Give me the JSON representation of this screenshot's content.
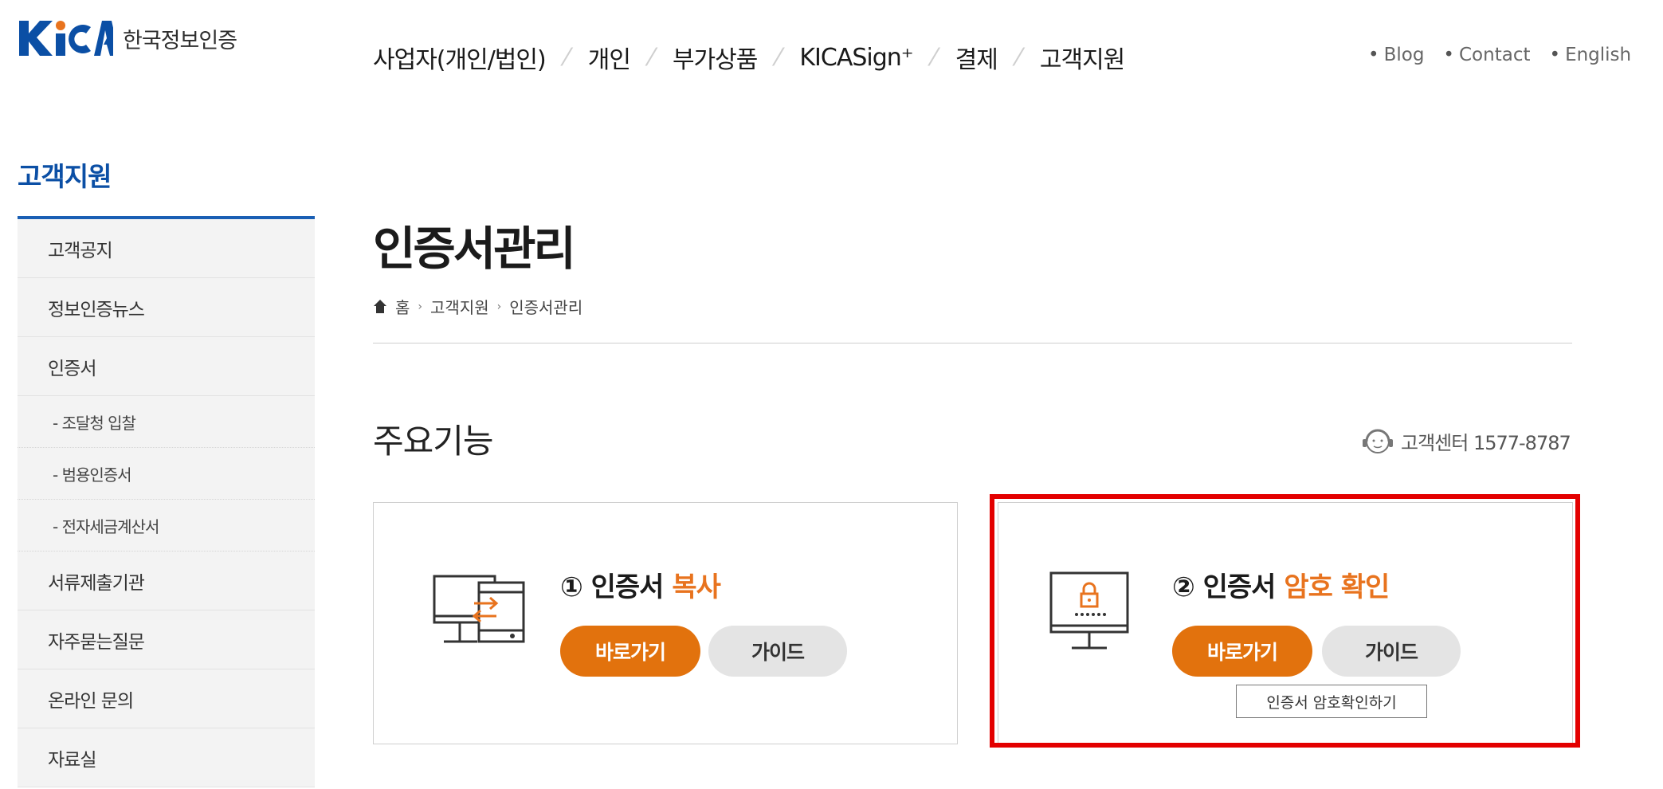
{
  "header": {
    "logo": {
      "text": "한국정보인증",
      "mark": "KICA"
    },
    "nav": [
      "사업자(개인/법인)",
      "개인",
      "부가상품",
      "KICASign⁺",
      "결제",
      "고객지원"
    ],
    "util": [
      "Blog",
      "Contact",
      "English"
    ]
  },
  "sidebar": {
    "title": "고객지원",
    "items": [
      {
        "label": "고객공지"
      },
      {
        "label": "정보인증뉴스"
      },
      {
        "label": "인증서"
      },
      {
        "label": "- 조달청 입찰"
      },
      {
        "label": "- 범용인증서"
      },
      {
        "label": "- 전자세금계산서"
      },
      {
        "label": "서류제출기관"
      },
      {
        "label": "자주묻는질문"
      },
      {
        "label": "온라인 문의"
      },
      {
        "label": "자료실"
      }
    ]
  },
  "main": {
    "title": "인증서관리",
    "breadcrumb": [
      "홈",
      "고객지원",
      "인증서관리"
    ],
    "section_title": "주요기능",
    "customer_center": "고객센터 1577-8787",
    "cards": [
      {
        "prefix": "① 인증서 ",
        "highlight": "복사",
        "go": "바로가기",
        "guide": "가이드"
      },
      {
        "prefix": "② 인증서 ",
        "highlight": "암호 확인",
        "go": "바로가기",
        "guide": "가이드"
      }
    ],
    "tooltip": "인증서 암호확인하기"
  },
  "colors": {
    "brand": "#0b4fa5",
    "accent": "#e2720d",
    "highlight_box": "#e30000"
  }
}
